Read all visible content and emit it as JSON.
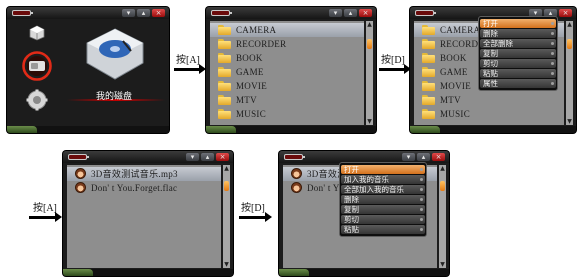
{
  "arrows": [
    {
      "label": "按[A]"
    },
    {
      "label": "按[D]"
    },
    {
      "label": "按[A]"
    },
    {
      "label": "按[D]"
    }
  ],
  "screen1": {
    "caption": "我的磁盘"
  },
  "folders": [
    "CAMERA",
    "RECORDER",
    "BOOK",
    "GAME",
    "MOVIE",
    "MTV",
    "MUSIC"
  ],
  "menu1": [
    "打开",
    "删除",
    "全部删除",
    "复制",
    "剪切",
    "粘贴",
    "属性"
  ],
  "files": [
    "3D音效测试音乐.mp3",
    "Don' t You.Forget.flac"
  ],
  "menu2": [
    "打开",
    "加入我的音乐",
    "全部加入我的音乐",
    "删除",
    "复制",
    "剪切",
    "粘贴"
  ],
  "window_buttons": {
    "minimize": "▾",
    "maximize": "▴",
    "close": "×"
  }
}
